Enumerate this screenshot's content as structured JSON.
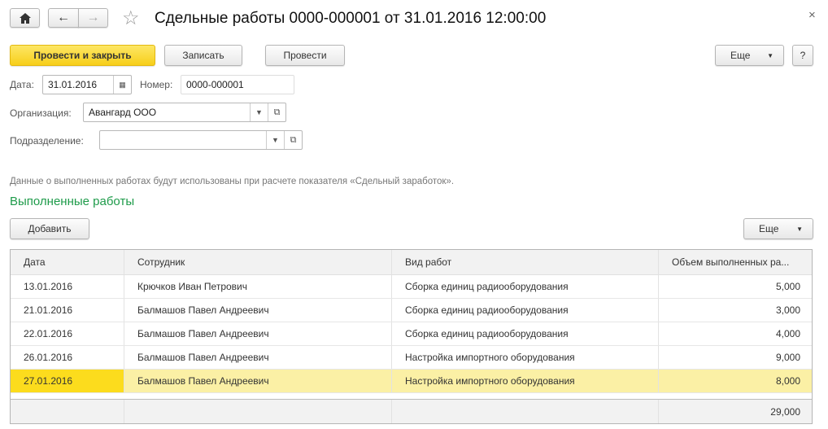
{
  "window": {
    "title": "Сдельные работы 0000-000001 от 31.01.2016 12:00:00",
    "close": "×"
  },
  "toolbar": {
    "post_close": "Провести и закрыть",
    "save": "Записать",
    "post": "Провести",
    "more": "Еще",
    "help": "?"
  },
  "form": {
    "date_label": "Дата:",
    "date_value": "31.01.2016",
    "number_label": "Номер:",
    "number_value": "0000-000001",
    "org_label": "Организация:",
    "org_value": "Авангард ООО",
    "dept_label": "Подразделение:",
    "dept_value": ""
  },
  "info": "Данные о выполненных работах будут использованы при расчете показателя «Сдельный заработок».",
  "section": {
    "title": "Выполненные работы",
    "add": "Добавить",
    "more": "Еще"
  },
  "table": {
    "headers": [
      "Дата",
      "Сотрудник",
      "Вид работ",
      "Объем выполненных ра..."
    ],
    "rows": [
      [
        "13.01.2016",
        "Крючков Иван Петрович",
        "Сборка единиц радиооборудования",
        "5,000"
      ],
      [
        "21.01.2016",
        "Балмашов Павел Андреевич",
        "Сборка единиц радиооборудования",
        "3,000"
      ],
      [
        "22.01.2016",
        "Балмашов Павел Андреевич",
        "Сборка единиц радиооборудования",
        "4,000"
      ],
      [
        "26.01.2016",
        "Балмашов Павел Андреевич",
        "Настройка импортного оборудования",
        "9,000"
      ],
      [
        "27.01.2016",
        "Балмашов Павел Андреевич",
        "Настройка импортного оборудования",
        "8,000"
      ]
    ],
    "total": "29,000"
  },
  "colors": {
    "accent": "#f7cf1a",
    "section_title": "#1e9b4a",
    "selected_row": "#fbf0a5"
  }
}
